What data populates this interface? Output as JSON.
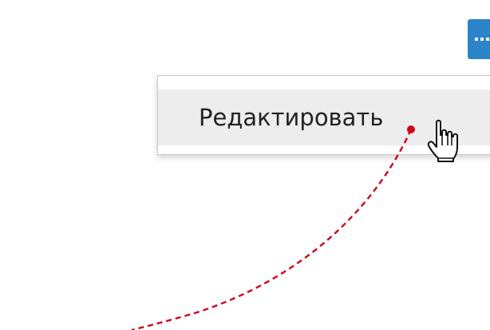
{
  "toolbar": {
    "more_icon": "more-dots-icon",
    "accent_color": "#2a84c8"
  },
  "context_menu": {
    "items": [
      {
        "label": "Редактировать",
        "state": "hovered"
      }
    ]
  },
  "annotation": {
    "pointer_icon": "hand-pointer-icon",
    "marker_color": "#d0021b"
  }
}
